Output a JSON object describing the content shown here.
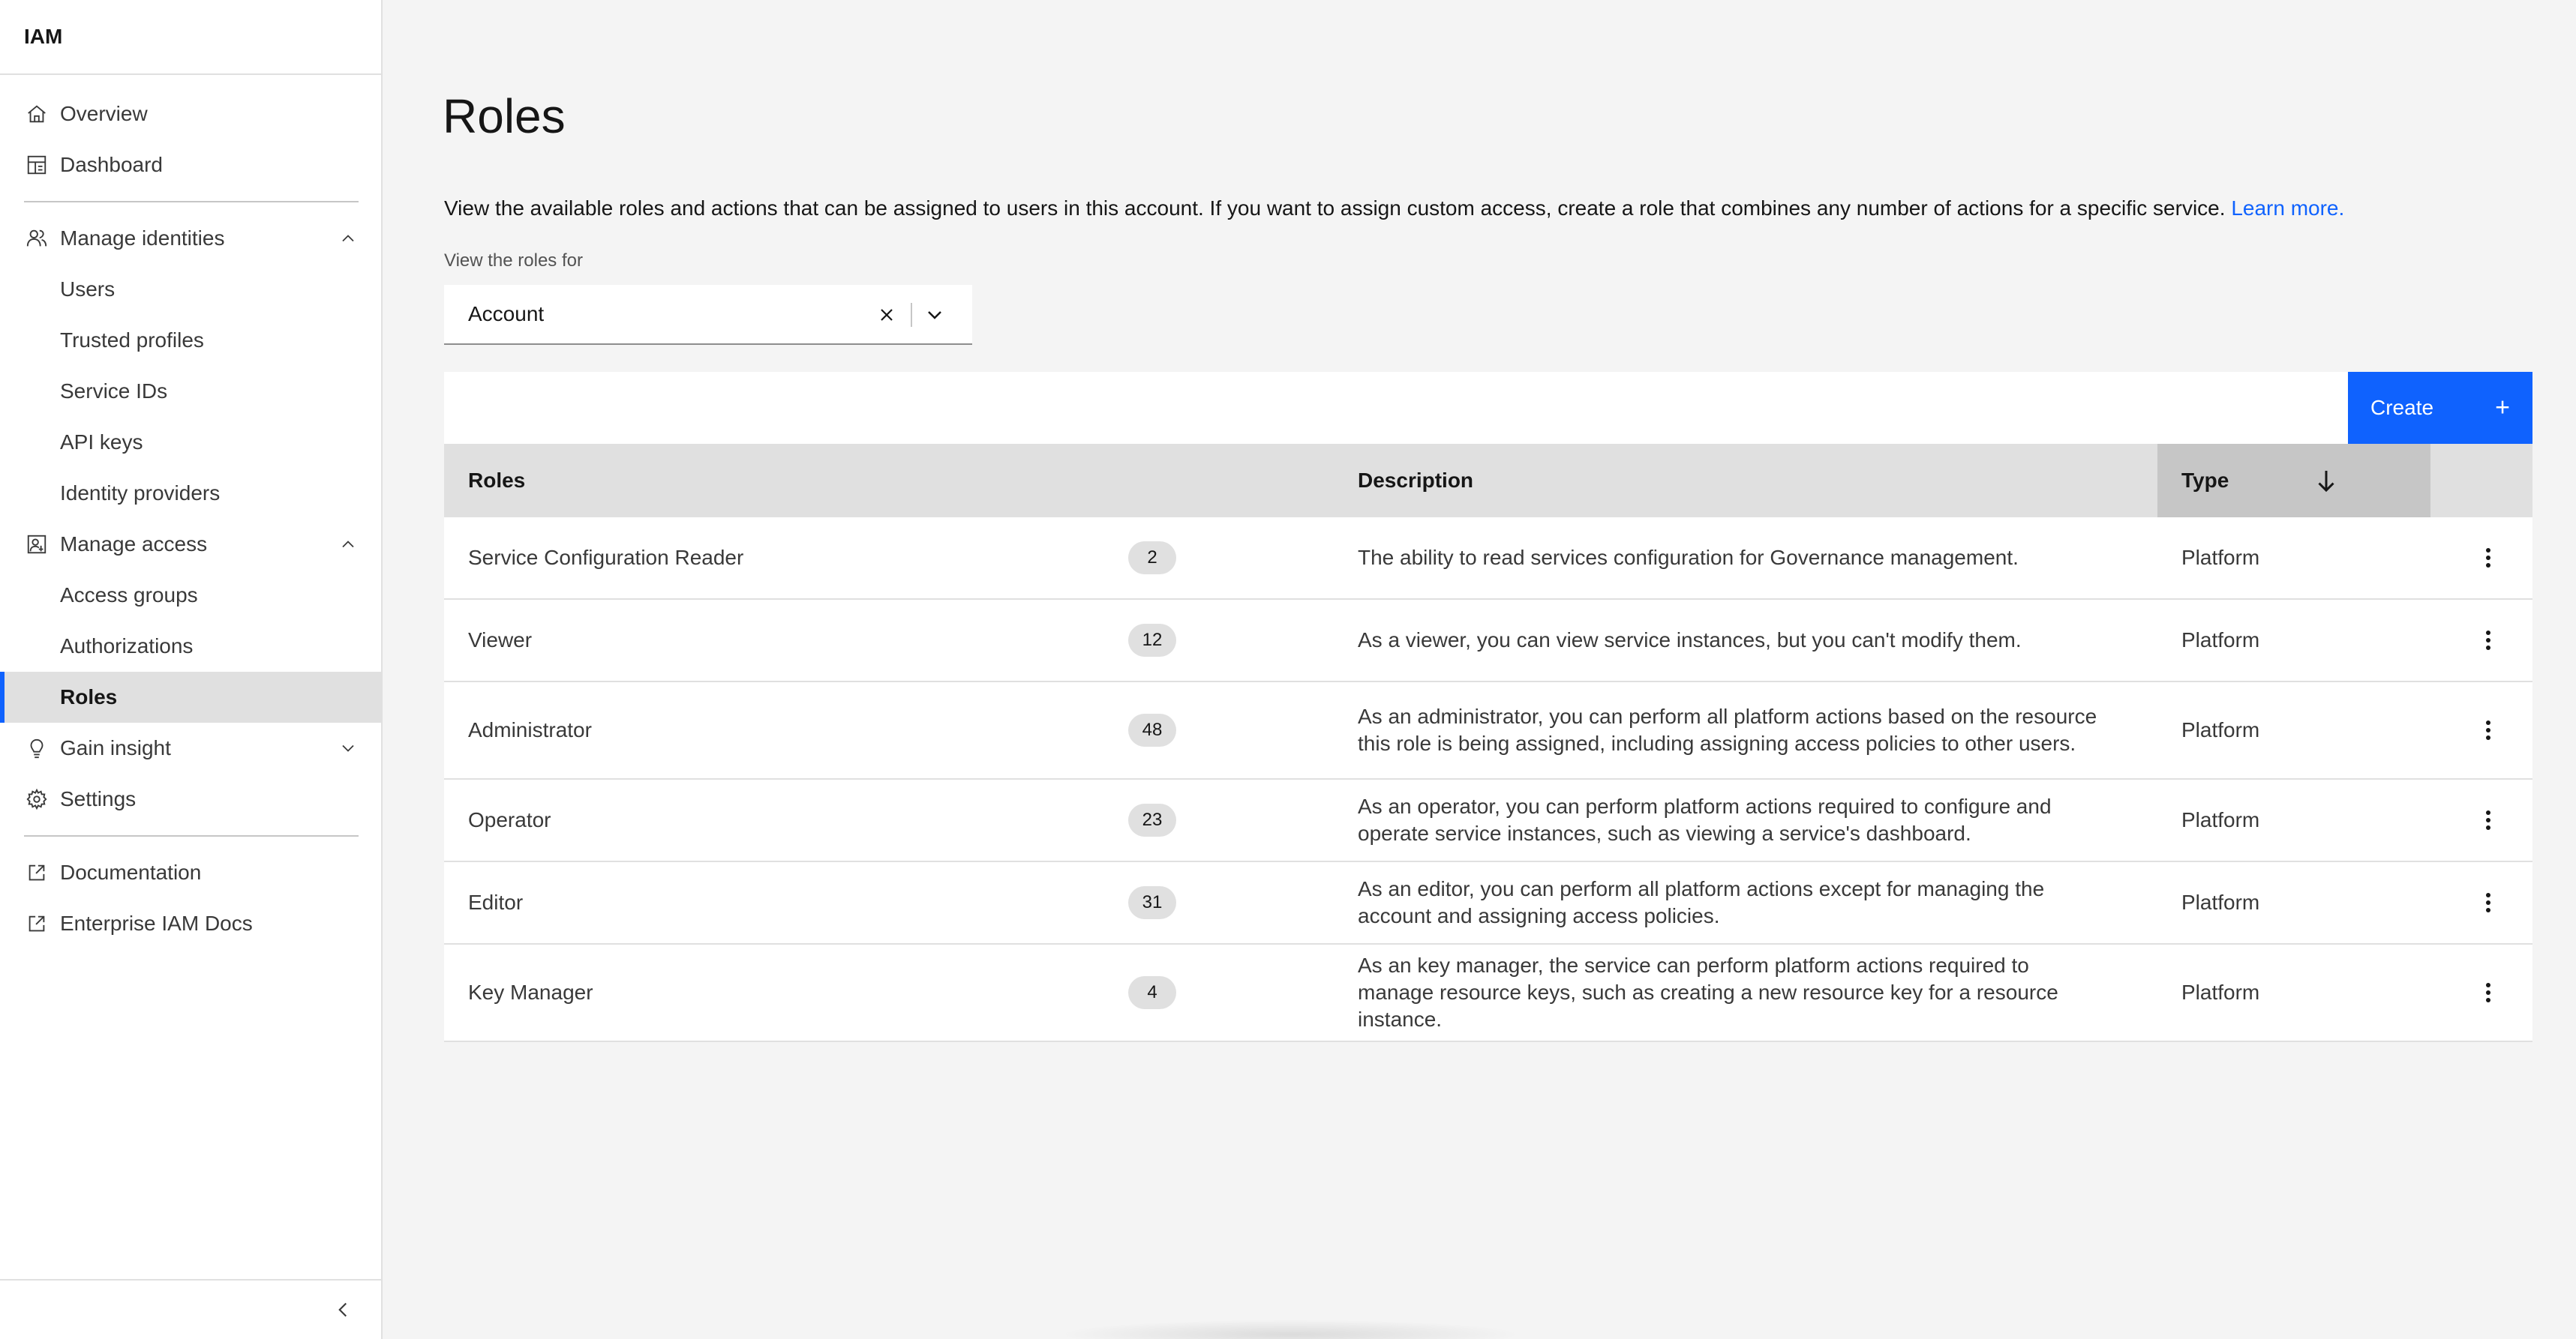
{
  "app": {
    "title": "IAM"
  },
  "sidebar": {
    "items": [
      {
        "label": "Overview",
        "icon": "home-icon"
      },
      {
        "label": "Dashboard",
        "icon": "dashboard-icon"
      },
      {
        "label": "Manage identities",
        "icon": "user-multiple-icon",
        "expanded": true
      },
      {
        "label": "Users"
      },
      {
        "label": "Trusted profiles"
      },
      {
        "label": "Service IDs"
      },
      {
        "label": "API keys"
      },
      {
        "label": "Identity providers"
      },
      {
        "label": "Manage access",
        "icon": "user-access-icon",
        "expanded": true
      },
      {
        "label": "Access groups"
      },
      {
        "label": "Authorizations"
      },
      {
        "label": "Roles",
        "active": true
      },
      {
        "label": "Gain insight",
        "icon": "lightbulb-icon",
        "expanded": false
      },
      {
        "label": "Settings",
        "icon": "gear-icon"
      },
      {
        "label": "Documentation",
        "icon": "launch-icon"
      },
      {
        "label": "Enterprise IAM Docs",
        "icon": "launch-icon"
      }
    ]
  },
  "main": {
    "title": "Roles",
    "intro": "View the available roles and actions that can be assigned to users in this account. If you want to assign custom access, create a role that combines any number of actions for a specific service.",
    "learn_more": "Learn more.",
    "filter_label": "View the roles for",
    "filter_value": "Account",
    "create_label": "Create",
    "create_icon": "+",
    "columns": {
      "roles": "Roles",
      "description": "Description",
      "type": "Type"
    },
    "rows": [
      {
        "name": "Service Configuration Reader",
        "count": "2",
        "description": "The ability to read services configuration for Governance management.",
        "type": "Platform"
      },
      {
        "name": "Viewer",
        "count": "12",
        "description": "As a viewer, you can view service instances, but you can't modify them.",
        "type": "Platform"
      },
      {
        "name": "Administrator",
        "count": "48",
        "description": "As an administrator, you can perform all platform actions based on the resource this role is being assigned, including assigning access policies to other users.",
        "type": "Platform"
      },
      {
        "name": "Operator",
        "count": "23",
        "description": "As an operator, you can perform platform actions required to configure and operate service instances, such as viewing a service's dashboard.",
        "type": "Platform"
      },
      {
        "name": "Editor",
        "count": "31",
        "description": "As an editor, you can perform all platform actions except for managing the account and assigning access policies.",
        "type": "Platform"
      },
      {
        "name": "Key Manager",
        "count": "4",
        "description": "As an key manager, the service can perform platform actions required to manage resource keys, such as creating a new resource key for a resource instance.",
        "type": "Platform"
      }
    ]
  },
  "colors": {
    "accent": "#0f62fe",
    "sidebar_active": "#e0e0e0",
    "header_bg": "#e0e0e0"
  }
}
